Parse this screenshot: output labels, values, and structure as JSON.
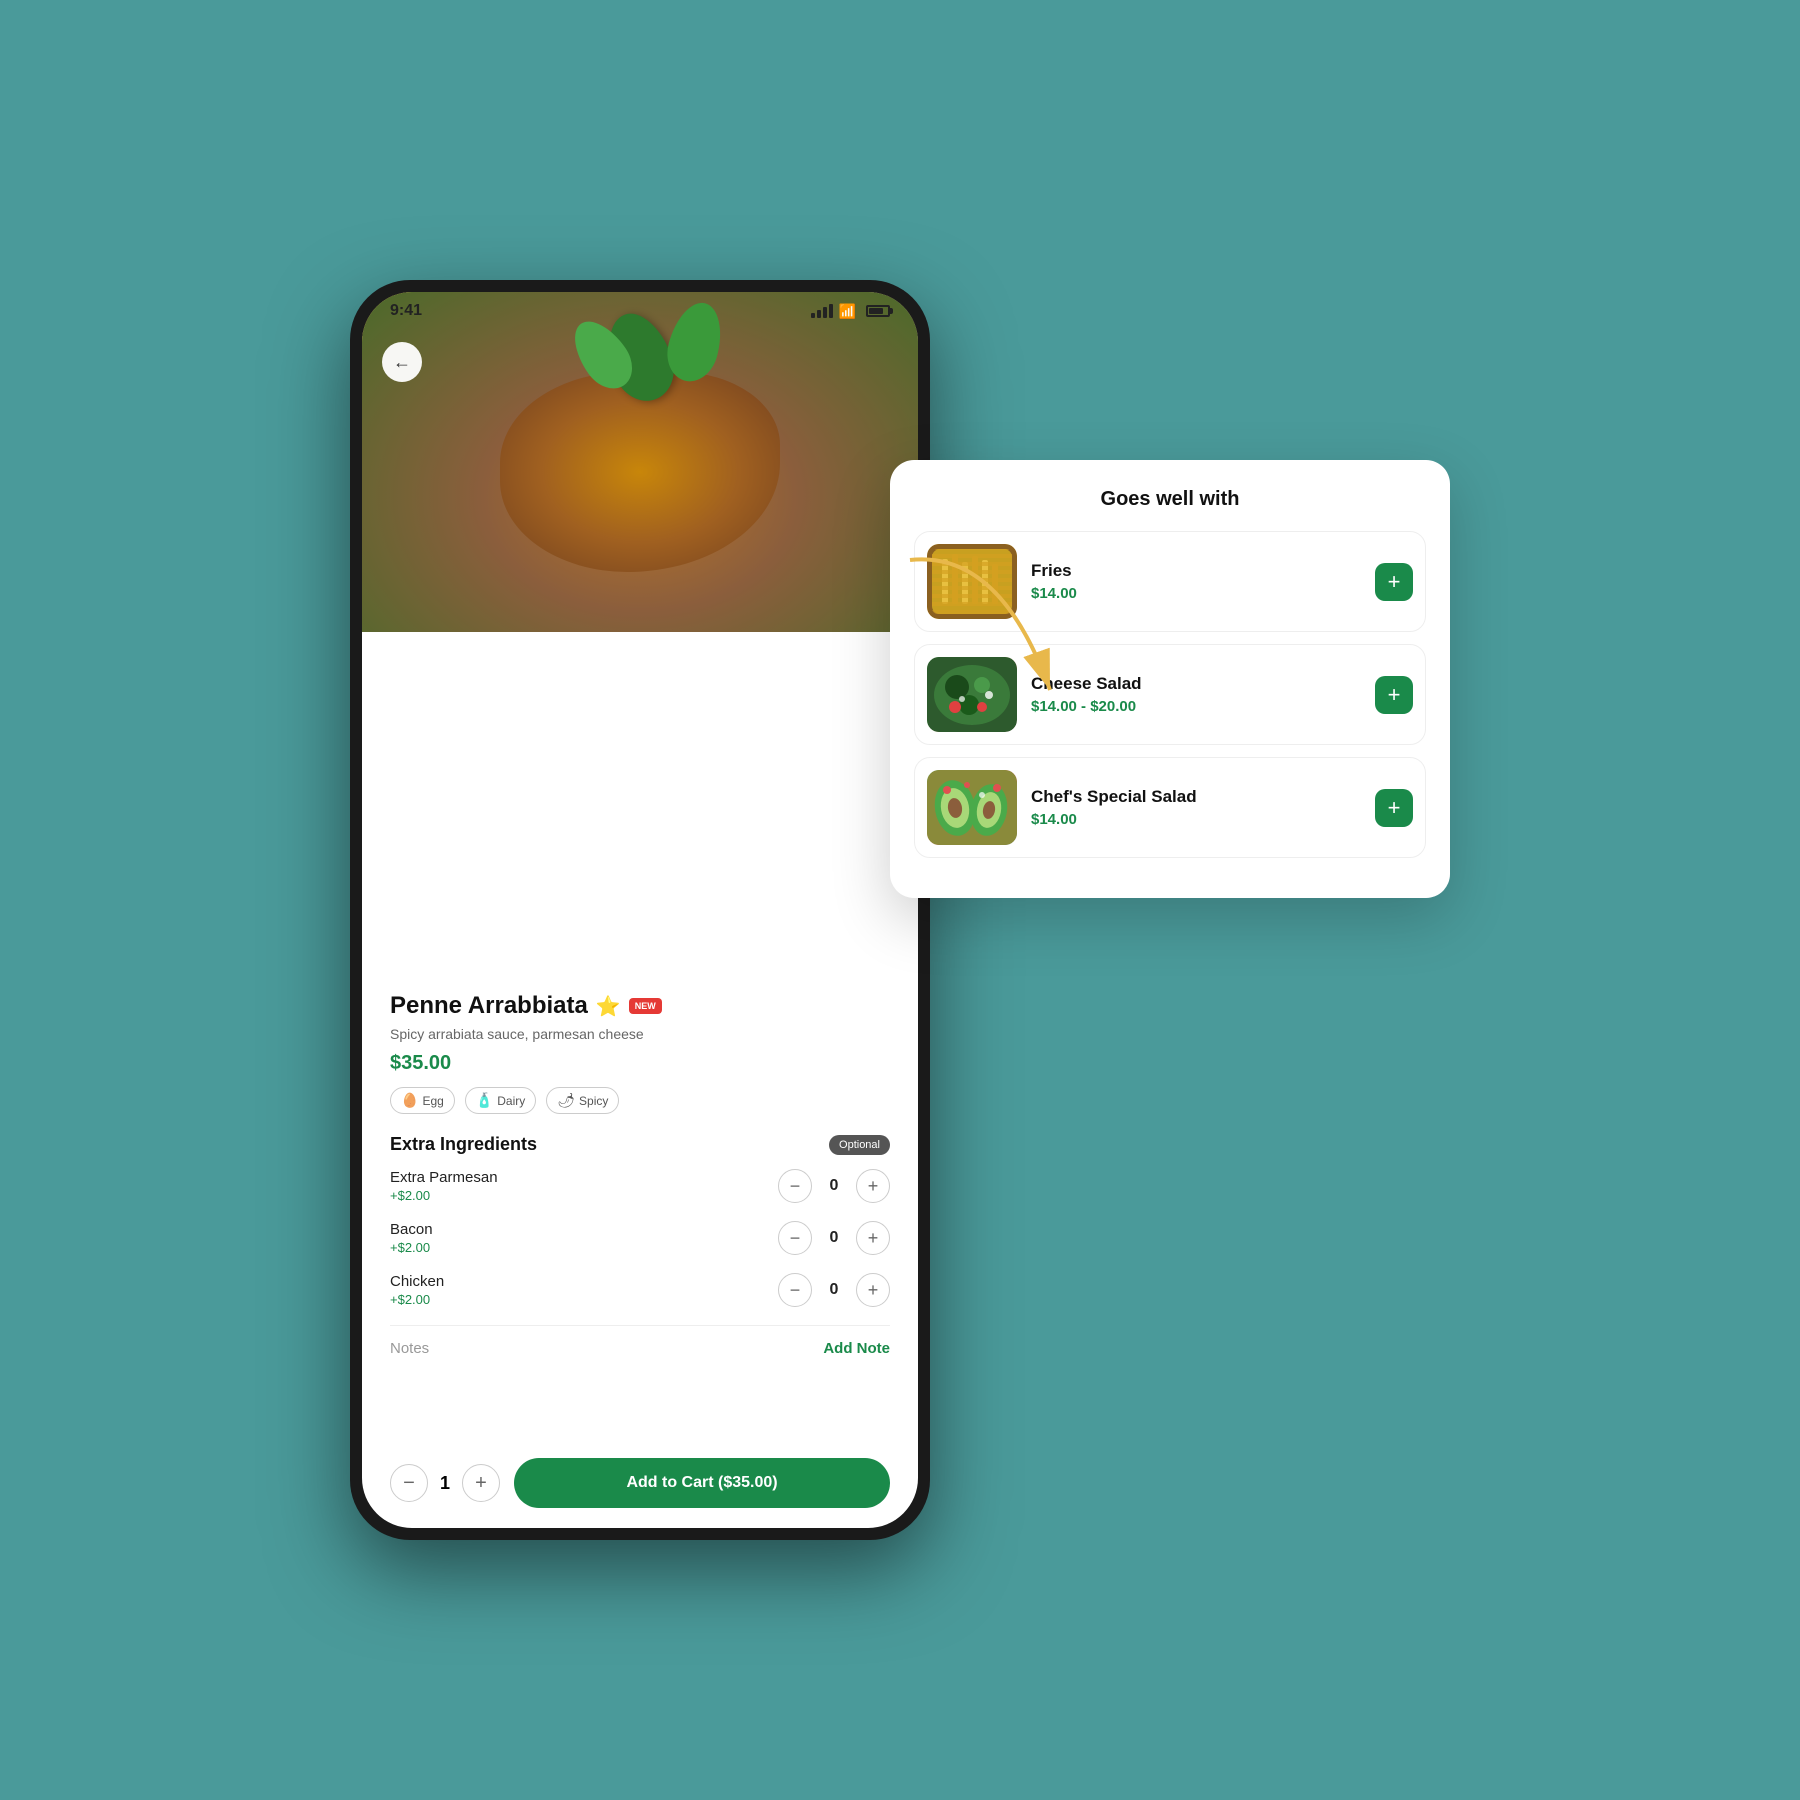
{
  "scene": {
    "background_color": "#4a9a9a"
  },
  "status_bar": {
    "time": "9:41"
  },
  "phone": {
    "back_button_label": "←",
    "item": {
      "name": "Penne Arrabbiata",
      "description": "Spicy arrabiata sauce, parmesan cheese",
      "price": "$35.00",
      "star": "⭐",
      "new_label": "NEW",
      "allergens": [
        {
          "icon": "🥚",
          "label": "Egg"
        },
        {
          "icon": "🧴",
          "label": "Dairy"
        },
        {
          "icon": "🌶",
          "label": "Spicy"
        }
      ]
    },
    "extra_ingredients": {
      "title": "Extra Ingredients",
      "optional_label": "Optional",
      "items": [
        {
          "name": "Extra Parmesan",
          "price": "+$2.00",
          "quantity": 0
        },
        {
          "name": "Bacon",
          "price": "+$2.00",
          "quantity": 0
        },
        {
          "name": "Chicken",
          "price": "+$2.00",
          "quantity": 0
        }
      ]
    },
    "notes": {
      "label": "Notes",
      "add_label": "Add Note"
    },
    "cart": {
      "quantity": 1,
      "button_label": "Add to Cart ($35.00)"
    }
  },
  "goes_well_with": {
    "title": "Goes well with",
    "items": [
      {
        "name": "Fries",
        "price": "$14.00",
        "thumb_type": "fries"
      },
      {
        "name": "Cheese Salad",
        "price": "$14.00 - $20.00",
        "thumb_type": "salad"
      },
      {
        "name": "Chef's Special Salad",
        "price": "$14.00",
        "thumb_type": "avocado"
      }
    ],
    "add_button_label": "+"
  }
}
